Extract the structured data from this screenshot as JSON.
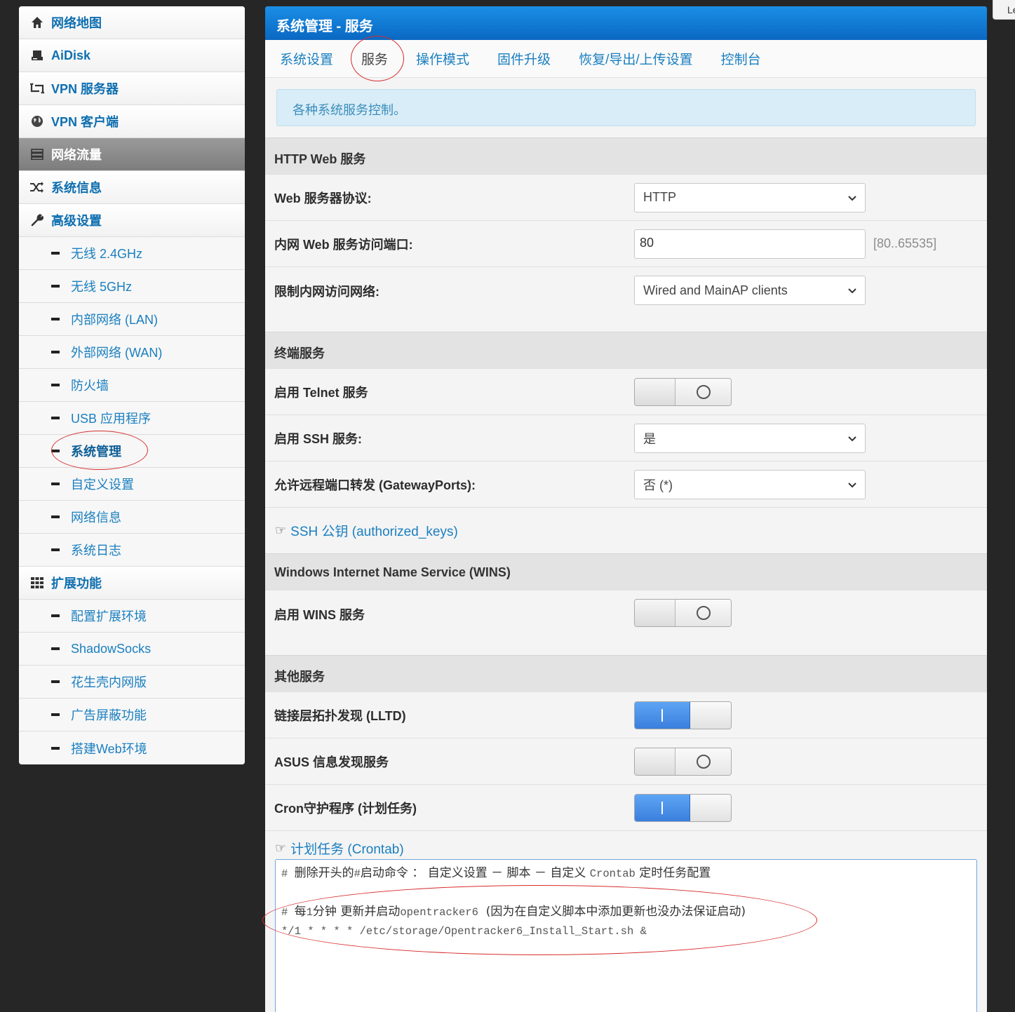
{
  "corner_text": "Le",
  "sidebar": {
    "top_items": [
      {
        "label": "网络地图",
        "icon": "home-icon"
      },
      {
        "label": "AiDisk",
        "icon": "hdd-icon"
      },
      {
        "label": "VPN 服务器",
        "icon": "retweet-icon"
      },
      {
        "label": "VPN 客户端",
        "icon": "globe-icon"
      },
      {
        "label": "网络流量",
        "icon": "tasks-icon"
      },
      {
        "label": "系统信息",
        "icon": "random-icon"
      },
      {
        "label": "高级设置",
        "icon": "wrench-icon"
      }
    ],
    "advanced_items": [
      "无线 2.4GHz",
      "无线 5GHz",
      "内部网络 (LAN)",
      "外部网络 (WAN)",
      "防火墙",
      "USB 应用程序",
      "系统管理",
      "自定义设置",
      "网络信息",
      "系统日志"
    ],
    "extensions": {
      "label": "扩展功能",
      "icon": "th-icon"
    },
    "extension_items": [
      "配置扩展环境",
      "ShadowSocks",
      "花生壳内网版",
      "广告屏蔽功能",
      "搭建Web环境"
    ]
  },
  "main": {
    "title": "系统管理 - 服务",
    "tabs": [
      "系统设置",
      "服务",
      "操作模式",
      "固件升级",
      "恢复/导出/上传设置",
      "控制台"
    ],
    "info": "各种系统服务控制。",
    "http_section": {
      "title": "HTTP Web 服务",
      "protocol_label": "Web 服务器协议:",
      "protocol_value": "HTTP",
      "port_label": "内网 Web 服务访问端口:",
      "port_value": "80",
      "port_range": "[80..65535]",
      "restrict_label": "限制内网访问网络:",
      "restrict_value": "Wired and MainAP clients"
    },
    "terminal_section": {
      "title": "终端服务",
      "telnet_label": "启用 Telnet 服务",
      "ssh_label": "启用 SSH 服务:",
      "ssh_value": "是",
      "gateway_label": "允许远程端口转发 (GatewayPorts):",
      "gateway_value": "否 (*)",
      "ssh_keys_link": "SSH 公钥 (authorized_keys)"
    },
    "wins_section": {
      "title": "Windows Internet Name Service (WINS)",
      "wins_label": "启用 WINS 服务"
    },
    "other_section": {
      "title": "其他服务",
      "lltd_label": "链接层拓扑发现 (LLTD)",
      "asus_label": "ASUS 信息发现服务",
      "cron_label": "Cron守护程序 (计划任务)",
      "crontab_link": "计划任务 (Crontab)"
    },
    "crontab": {
      "line1_hash": "# ",
      "line1_a": "删除开头的",
      "line1_b": "#",
      "line1_c": "启动命令 ： 自定义设置 － 脚本 － 自定义 ",
      "line1_d": "Crontab",
      "line1_e": " 定时任务配置",
      "line3_hash": "# ",
      "line3_a": "每",
      "line3_b": "1",
      "line3_c": "分钟 更新并启动",
      "line3_d": "opentracker6",
      "line3_e": "  (因为在自定义脚本中添加更新也没办法保证启动)",
      "line4": "*/1 * * * * /etc/storage/Opentracker6_Install_Start.sh &"
    },
    "toggle_states": {
      "telnet": "off",
      "wins": "off",
      "lltd": "on",
      "asus": "off",
      "cron": "on"
    }
  },
  "colors": {
    "header_blue": "#0a68c2",
    "link_blue": "#1a7fc0",
    "annotation_red": "#d72b2b",
    "toggle_on": "#3a7fdc"
  }
}
